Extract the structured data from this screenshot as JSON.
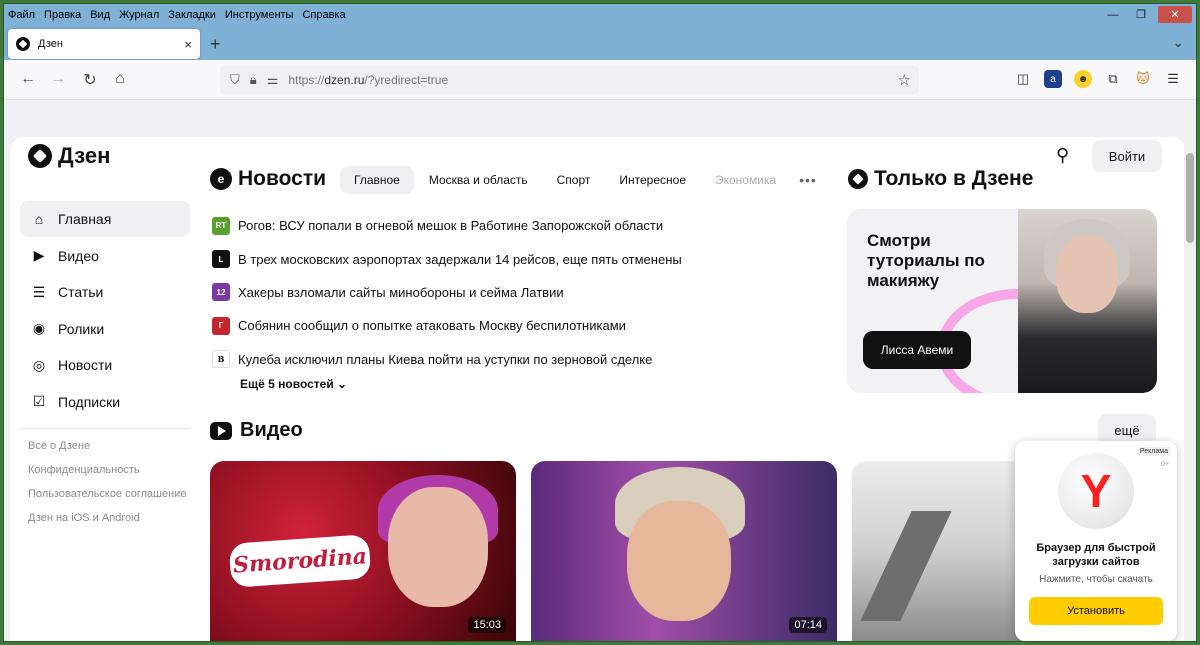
{
  "menu": [
    "Файл",
    "Правка",
    "Вид",
    "Журнал",
    "Закладки",
    "Инструменты",
    "Справка"
  ],
  "window_controls": {
    "minimize": "—",
    "restore": "❐",
    "close": "✕"
  },
  "tab": {
    "title": "Дзен",
    "close": "×"
  },
  "newtab": "+",
  "url": {
    "prefix": "https://",
    "host": "dzen.ru",
    "path": "/?yredirect=true"
  },
  "logo": "Дзен",
  "login": "Войти",
  "sidebar": {
    "items": [
      {
        "label": "Главная",
        "icon": "home-icon",
        "glyph": "⌂"
      },
      {
        "label": "Видео",
        "icon": "video-icon",
        "glyph": "▶"
      },
      {
        "label": "Статьи",
        "icon": "articles-icon",
        "glyph": "☰"
      },
      {
        "label": "Ролики",
        "icon": "clips-icon",
        "glyph": "◉"
      },
      {
        "label": "Новости",
        "icon": "news-icon",
        "glyph": "◎"
      },
      {
        "label": "Подписки",
        "icon": "subscriptions-icon",
        "glyph": "☑"
      }
    ],
    "footer": [
      "Всё о Дзене",
      "Конфиденциальность",
      "Пользовательское соглашение",
      "Дзен на iOS и Android"
    ]
  },
  "news": {
    "title": "Новости",
    "tabs": [
      "Главное",
      "Москва и область",
      "Спорт",
      "Интересное",
      "Экономика"
    ],
    "dots": "•••",
    "items": [
      {
        "src": "RT",
        "color": "#5aa02c",
        "text": "Рогов: ВСУ попали в огневой мешок в Работине Запорожской области"
      },
      {
        "src": "L",
        "color": "#111111",
        "text": "В трех московских аэропортах задержали 14 рейсов, еще пять отменены"
      },
      {
        "src": "12",
        "color": "#7a3a9e",
        "text": "Хакеры взломали сайты минобороны и сейма Латвии"
      },
      {
        "src": "Г",
        "color": "#c4262e",
        "text": "Собянин сообщил о попытке атаковать Москву беспилотниками"
      },
      {
        "src": "В",
        "color": "#ffffff",
        "text": "Кулеба исключил планы Киева пойти на уступки по зерновой сделке"
      }
    ],
    "more": "Ещё 5 новостей ⌄"
  },
  "only": {
    "title": "Только в Дзене",
    "promo_head": "Смотри туториалы по макияжу",
    "promo_author": "Лисса Авеми"
  },
  "video": {
    "title": "Видео",
    "more": "ещё",
    "cards": [
      {
        "brand": "Smorodina",
        "duration": "15:03"
      },
      {
        "duration": "07:14"
      }
    ]
  },
  "ad": {
    "tag": "Реклама",
    "age": "0+",
    "logo": "Y",
    "headline": "Браузер для быстрой загрузки сайтов",
    "sub": "Нажмите, чтобы скачать",
    "button": "Установить"
  }
}
